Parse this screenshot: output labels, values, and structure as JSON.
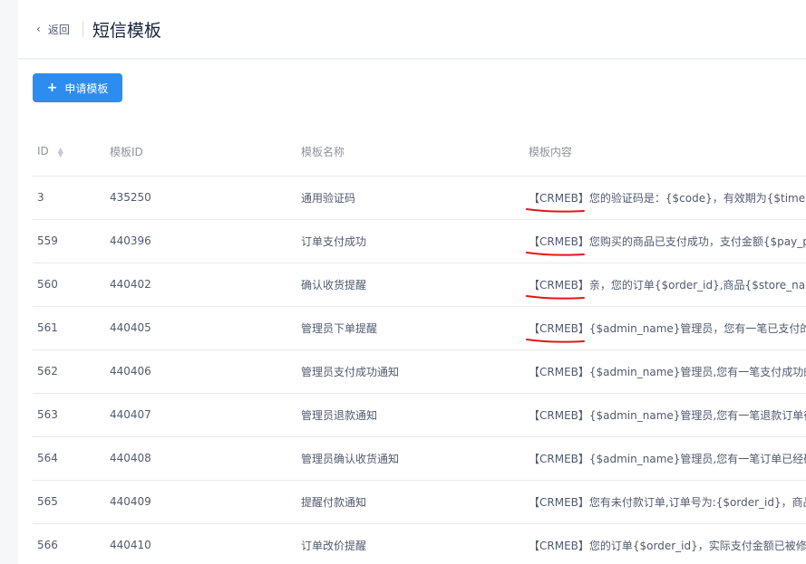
{
  "header": {
    "back_label": "返回",
    "title": "短信模板"
  },
  "toolbar": {
    "apply_label": "申请模板"
  },
  "table": {
    "columns": [
      "ID",
      "模板ID",
      "模板名称",
      "模板内容"
    ],
    "rows": [
      {
        "id": "3",
        "tid": "435250",
        "name": "通用验证码",
        "content": "【CRMEB】您的验证码是：{$code}，有效期为{$time}分钟"
      },
      {
        "id": "559",
        "tid": "440396",
        "name": "订单支付成功",
        "content": "【CRMEB】您购买的商品已支付成功，支付金额{$pay_price}"
      },
      {
        "id": "560",
        "tid": "440402",
        "name": "确认收货提醒",
        "content": "【CRMEB】亲，您的订单{$order_id},商品{$store_name}已"
      },
      {
        "id": "561",
        "tid": "440405",
        "name": "管理员下单提醒",
        "content": "【CRMEB】{$admin_name}管理员，您有一笔已支付的订单"
      },
      {
        "id": "562",
        "tid": "440406",
        "name": "管理员支付成功通知",
        "content": "【CRMEB】{$admin_name}管理员,您有一笔支付成功的订单"
      },
      {
        "id": "563",
        "tid": "440407",
        "name": "管理员退款通知",
        "content": "【CRMEB】{$admin_name}管理员,您有一笔退款订单待处理"
      },
      {
        "id": "564",
        "tid": "440408",
        "name": "管理员确认收货通知",
        "content": "【CRMEB】{$admin_name}管理员,您有一笔订单已经确认收货"
      },
      {
        "id": "565",
        "tid": "440409",
        "name": "提醒付款通知",
        "content": "【CRMEB】您有未付款订单,订单号为:{$order_id}，商品数量"
      },
      {
        "id": "566",
        "tid": "440410",
        "name": "订单改价提醒",
        "content": "【CRMEB】您的订单{$order_id}，实际支付金额已被修改为"
      }
    ]
  },
  "colors": {
    "primary": "#2d8cf0",
    "annotation": "#e8141a"
  },
  "icons": {
    "back": "chevron-left-icon",
    "apply": "plus-icon",
    "sort": "sort-caret-icon"
  }
}
